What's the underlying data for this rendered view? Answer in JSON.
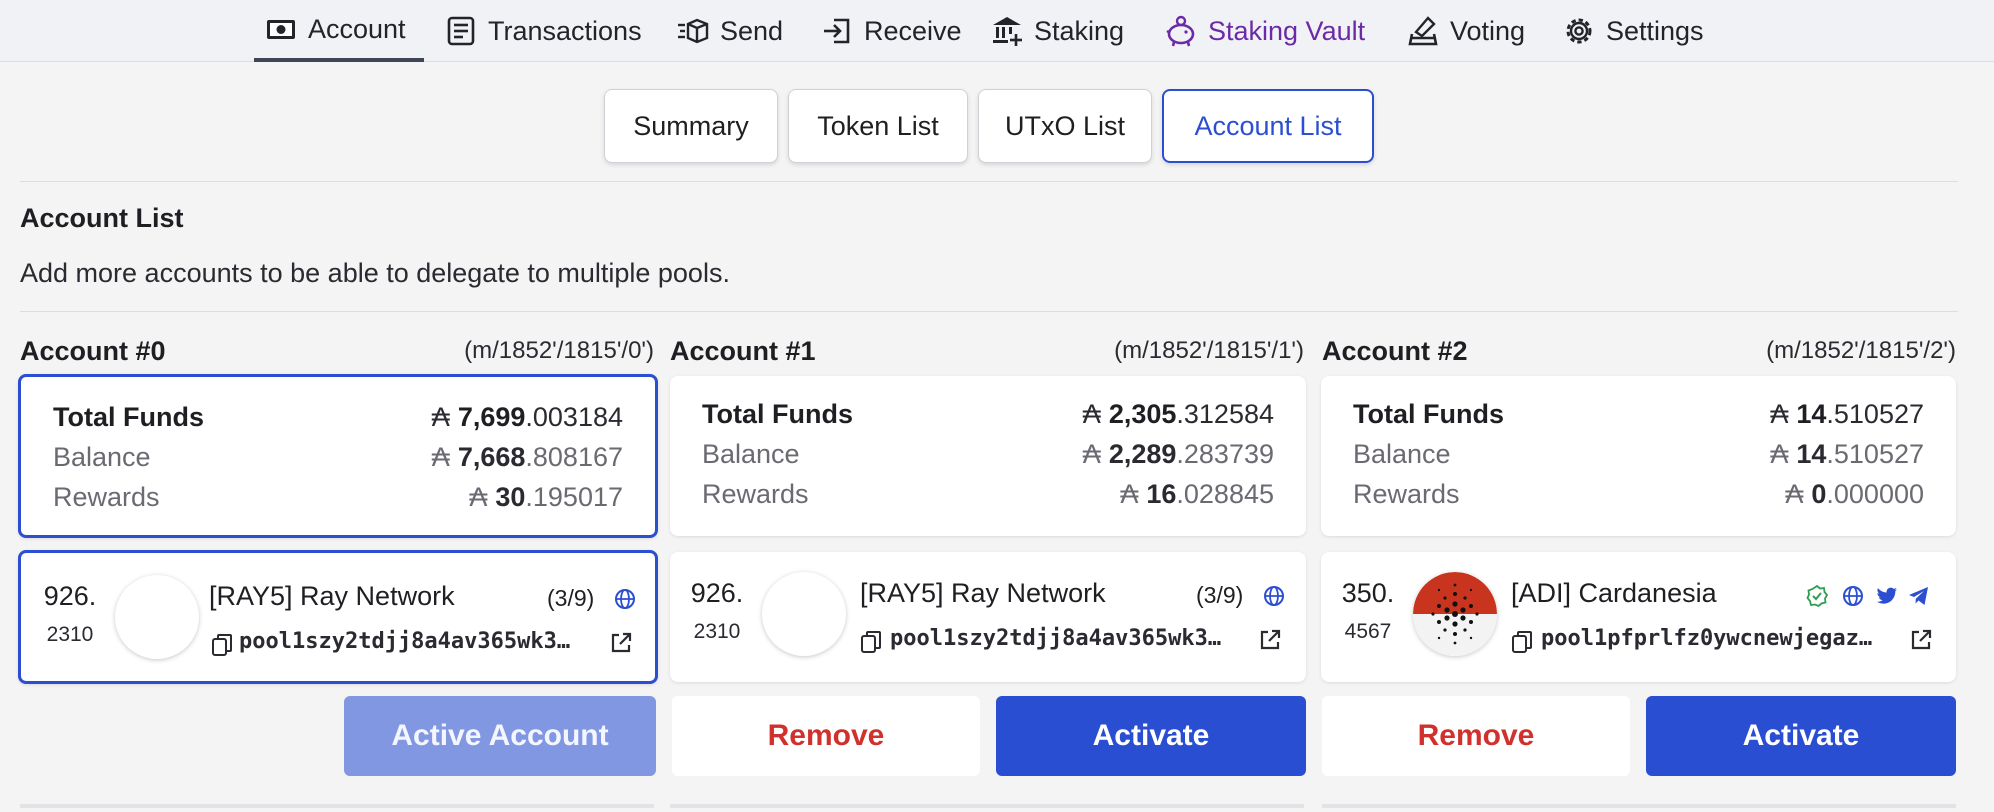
{
  "nav": {
    "items": [
      {
        "label": "Account",
        "icon": "cash-icon"
      },
      {
        "label": "Transactions",
        "icon": "document-icon"
      },
      {
        "label": "Send",
        "icon": "send-box-icon"
      },
      {
        "label": "Receive",
        "icon": "receive-icon"
      },
      {
        "label": "Staking",
        "icon": "bank-icon"
      },
      {
        "label": "Staking Vault",
        "icon": "piggy-bank-icon"
      },
      {
        "label": "Voting",
        "icon": "vote-icon"
      },
      {
        "label": "Settings",
        "icon": "gear-icon"
      }
    ],
    "active": "Account",
    "accent_vault": "#6b2ba6"
  },
  "subtabs": {
    "items": [
      "Summary",
      "Token List",
      "UTxO List",
      "Account List"
    ],
    "selected": "Account List",
    "accent": "#2c4fd2"
  },
  "section": {
    "title": "Account List",
    "description": "Add more accounts to be able to delegate to multiple pools."
  },
  "labels": {
    "total_funds": "Total Funds",
    "balance": "Balance",
    "rewards": "Rewards",
    "currency_symbol": "₳"
  },
  "accounts": [
    {
      "name": "Account #0",
      "path": "(m/1852'/1815'/0')",
      "active": true,
      "total": {
        "int": "7,699",
        "dec": ".003184"
      },
      "balance": {
        "int": "7,668",
        "dec": ".808167"
      },
      "rewards": {
        "int": "30",
        "dec": ".195017"
      },
      "pool": {
        "num": "926.",
        "sub": "2310",
        "name": "[RAY5] Ray Network",
        "saturation": "(3/9)",
        "id": "pool1szy2tdjj8a4av365wk3…",
        "icons": [
          "globe-icon"
        ]
      },
      "buttons": {
        "active_label": "Active Account"
      }
    },
    {
      "name": "Account #1",
      "path": "(m/1852'/1815'/1')",
      "active": false,
      "total": {
        "int": "2,305",
        "dec": ".312584"
      },
      "balance": {
        "int": "2,289",
        "dec": ".283739"
      },
      "rewards": {
        "int": "16",
        "dec": ".028845"
      },
      "pool": {
        "num": "926.",
        "sub": "2310",
        "name": "[RAY5] Ray Network",
        "saturation": "(3/9)",
        "id": "pool1szy2tdjj8a4av365wk3…",
        "icons": [
          "globe-icon"
        ]
      },
      "buttons": {
        "remove_label": "Remove",
        "activate_label": "Activate"
      }
    },
    {
      "name": "Account #2",
      "path": "(m/1852'/1815'/2')",
      "active": false,
      "total": {
        "int": "14",
        "dec": ".510527"
      },
      "balance": {
        "int": "14",
        "dec": ".510527"
      },
      "rewards": {
        "int": "0",
        "dec": ".000000"
      },
      "pool": {
        "num": "350.",
        "sub": "4567",
        "name": "[ADI] Cardanesia",
        "saturation": "",
        "id": "pool1pfprlfz0ywcnewjegaz…",
        "icons": [
          "verified-icon",
          "globe-icon",
          "twitter-icon",
          "telegram-icon"
        ]
      },
      "buttons": {
        "remove_label": "Remove",
        "activate_label": "Activate"
      }
    }
  ],
  "colors": {
    "primary": "#2a4ed1",
    "active_button": "#8297e1",
    "remove": "#d0312d",
    "verified": "#2e9e52"
  }
}
